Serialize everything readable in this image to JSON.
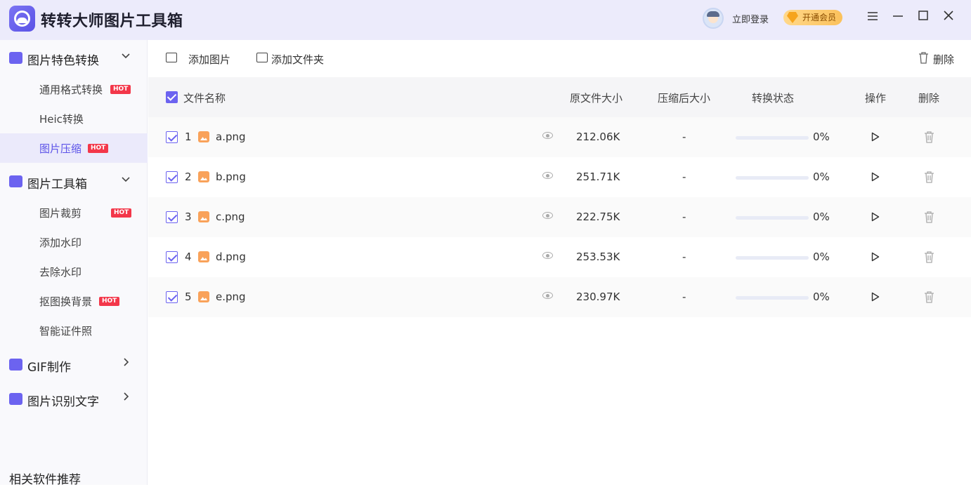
{
  "app": {
    "title": "转转大师图片工具箱"
  },
  "header": {
    "login": "立即登录",
    "vip": "开通会员"
  },
  "sidebar": {
    "groups": [
      {
        "label": "图片特色转换",
        "items": [
          {
            "label": "通用格式转换",
            "hot": "HOT"
          },
          {
            "label": "Heic转换"
          },
          {
            "label": "图片压缩",
            "hot": "HOT",
            "active": true
          }
        ]
      },
      {
        "label": "图片工具箱",
        "items": [
          {
            "label": "图片裁剪",
            "hot": "HOT"
          },
          {
            "label": "添加水印"
          },
          {
            "label": "去除水印"
          },
          {
            "label": "抠图换背景",
            "hot": "HOT"
          },
          {
            "label": "智能证件照"
          }
        ]
      },
      {
        "label": "GIF制作"
      },
      {
        "label": "图片识别文字"
      }
    ],
    "related": "相关软件推荐"
  },
  "toolbar": {
    "add_image": "添加图片",
    "add_folder": "添加文件夹",
    "delete": "删除"
  },
  "table": {
    "headers": {
      "name": "文件名称",
      "orig_size": "原文件大小",
      "comp_size": "压缩后大小",
      "status": "转换状态",
      "action": "操作",
      "delete": "删除"
    },
    "rows": [
      {
        "index": "1",
        "name": "a.png",
        "orig_size": "212.06K",
        "comp_size": "-",
        "progress": "0%",
        "progress_value": 0
      },
      {
        "index": "2",
        "name": "b.png",
        "orig_size": "251.71K",
        "comp_size": "-",
        "progress": "0%",
        "progress_value": 0
      },
      {
        "index": "3",
        "name": "c.png",
        "orig_size": "222.75K",
        "comp_size": "-",
        "progress": "0%",
        "progress_value": 0
      },
      {
        "index": "4",
        "name": "d.png",
        "orig_size": "253.53K",
        "comp_size": "-",
        "progress": "0%",
        "progress_value": 0
      },
      {
        "index": "5",
        "name": "e.png",
        "orig_size": "230.97K",
        "comp_size": "-",
        "progress": "0%",
        "progress_value": 0
      }
    ]
  },
  "colors": {
    "accent": "#6c63f0",
    "hot": "#f3374a",
    "titlebar": "#ecebfb",
    "vip": "#fbc15b"
  }
}
